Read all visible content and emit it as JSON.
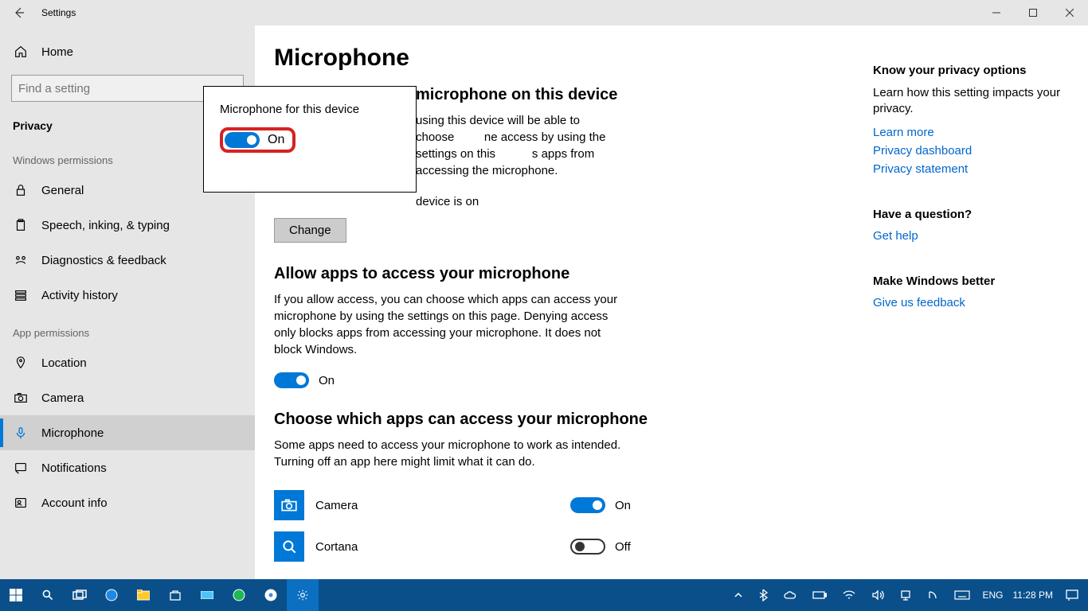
{
  "titlebar": {
    "title": "Settings"
  },
  "sidebar": {
    "home": "Home",
    "search_placeholder": "Find a setting",
    "section": "Privacy",
    "cat1": "Windows permissions",
    "cat2": "App permissions",
    "items_win": [
      {
        "label": "General"
      },
      {
        "label": "Speech, inking, & typing"
      },
      {
        "label": "Diagnostics & feedback"
      },
      {
        "label": "Activity history"
      }
    ],
    "items_app": [
      {
        "label": "Location"
      },
      {
        "label": "Camera"
      },
      {
        "label": "Microphone"
      },
      {
        "label": "Notifications"
      },
      {
        "label": "Account info"
      }
    ]
  },
  "main": {
    "h1": "Microphone",
    "section1": {
      "title": "microphone on this device",
      "desc": "using this device will be able to choose         ne access by using the settings on this           s apps from accessing the microphone.",
      "status": "device is on",
      "button": "Change"
    },
    "section2": {
      "title": "Allow apps to access your microphone",
      "desc": "If you allow access, you can choose which apps can access your microphone by using the settings on this page. Denying access only blocks apps from accessing your microphone. It does not block Windows.",
      "toggle_label": "On"
    },
    "section3": {
      "title": "Choose which apps can access your microphone",
      "desc": "Some apps need to access your microphone to work as intended. Turning off an app here might limit what it can do.",
      "apps": [
        {
          "name": "Camera",
          "state": "On",
          "on": true,
          "icon": "camera-icon"
        },
        {
          "name": "Cortana",
          "state": "Off",
          "on": false,
          "icon": "search-icon"
        }
      ]
    }
  },
  "popup": {
    "title": "Microphone for this device",
    "toggle_label": "On"
  },
  "rightpane": {
    "block1": {
      "title": "Know your privacy options",
      "text": "Learn how this setting impacts your privacy.",
      "links": [
        "Learn more",
        "Privacy dashboard",
        "Privacy statement"
      ]
    },
    "block2": {
      "title": "Have a question?",
      "links": [
        "Get help"
      ]
    },
    "block3": {
      "title": "Make Windows better",
      "links": [
        "Give us feedback"
      ]
    }
  },
  "taskbar": {
    "lang": "ENG",
    "time": "11:28 PM"
  }
}
